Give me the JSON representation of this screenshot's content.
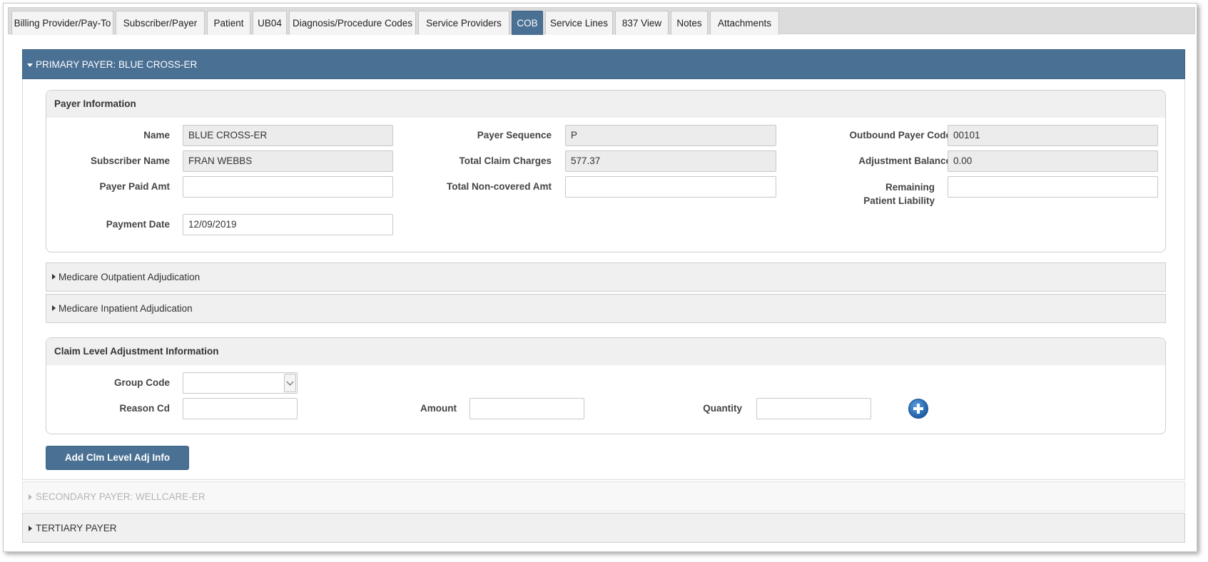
{
  "tabs": [
    {
      "label": "Billing Provider/Pay-To",
      "active": false
    },
    {
      "label": "Subscriber/Payer",
      "active": false
    },
    {
      "label": "Patient",
      "active": false
    },
    {
      "label": "UB04",
      "active": false
    },
    {
      "label": "Diagnosis/Procedure Codes",
      "active": false
    },
    {
      "label": "Service Providers",
      "active": false
    },
    {
      "label": "COB",
      "active": true
    },
    {
      "label": "Service Lines",
      "active": false
    },
    {
      "label": "837 View",
      "active": false
    },
    {
      "label": "Notes",
      "active": false
    },
    {
      "label": "Attachments",
      "active": false
    }
  ],
  "colors": {
    "accent": "#4a7094",
    "readonly_bg": "#ececec",
    "panel_head_bg": "#f0f0f0"
  },
  "primary": {
    "header": "PRIMARY PAYER: BLUE CROSS-ER",
    "payer_info": {
      "title": "Payer Information",
      "name_label": "Name",
      "name_value": "BLUE CROSS-ER",
      "subscriber_label": "Subscriber Name",
      "subscriber_value": "FRAN WEBBS",
      "paid_amt_label": "Payer Paid Amt",
      "paid_amt_value": "",
      "payment_date_label": "Payment Date",
      "payment_date_value": "12/09/2019",
      "sequence_label": "Payer Sequence",
      "sequence_value": "P",
      "total_charges_label": "Total Claim Charges",
      "total_charges_value": "577.37",
      "noncovered_label": "Total Non-covered Amt",
      "noncovered_value": "",
      "outbound_label": "Outbound Payer Code",
      "outbound_value": "00101",
      "adj_balance_label": "Adjustment Balance",
      "adj_balance_value": "0.00",
      "remaining_label": "Remaining Patient Liability",
      "remaining_value": ""
    },
    "medicare_outpatient": "Medicare Outpatient Adjudication",
    "medicare_inpatient": "Medicare Inpatient Adjudication",
    "claim_adj": {
      "title": "Claim Level Adjustment Information",
      "group_code_label": "Group Code",
      "group_code_value": "",
      "reason_label": "Reason Cd",
      "reason_value": "",
      "amount_label": "Amount",
      "amount_value": "",
      "quantity_label": "Quantity",
      "quantity_value": ""
    },
    "add_button": "Add Clm Level Adj Info"
  },
  "secondary": {
    "header": "SECONDARY PAYER: WELLCARE-ER"
  },
  "tertiary": {
    "header": "TERTIARY PAYER"
  }
}
